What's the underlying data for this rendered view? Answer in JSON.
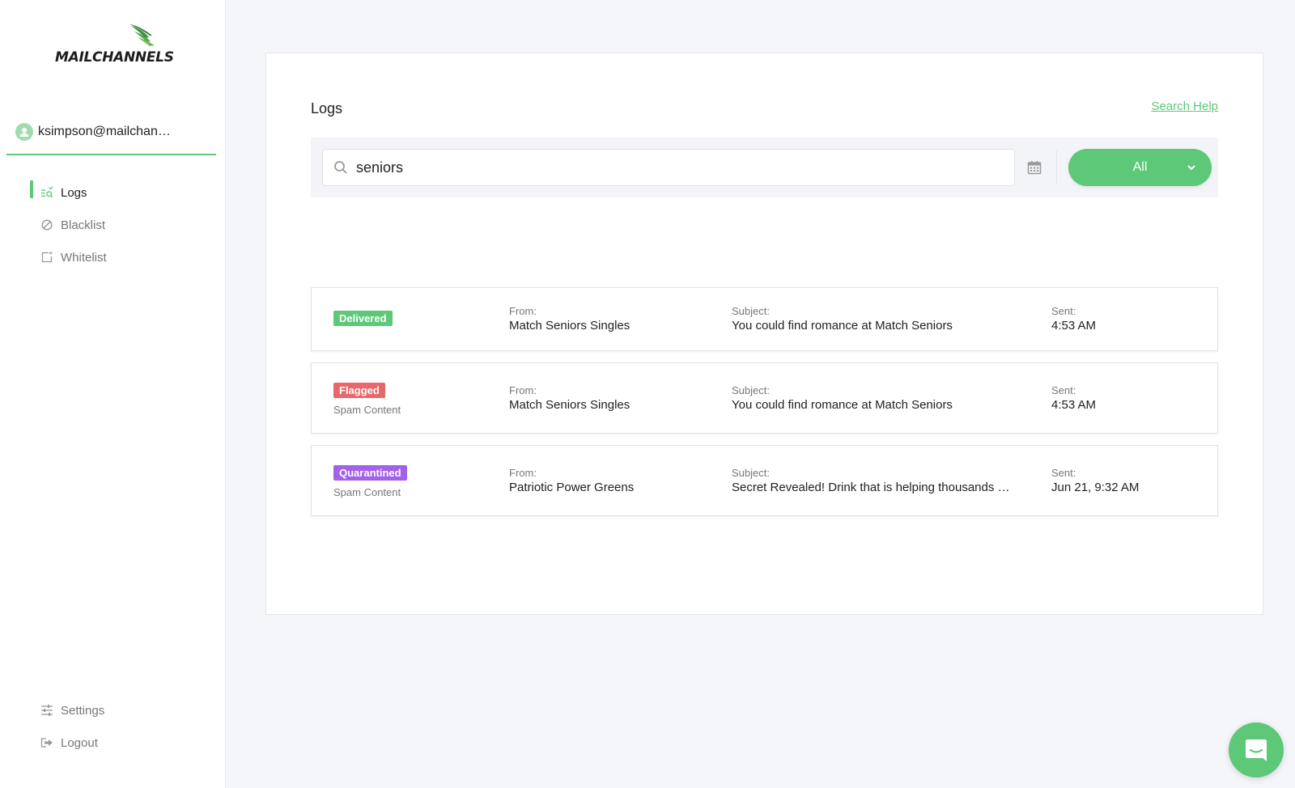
{
  "brand": {
    "name": "MAILCHANNELS",
    "accent": "#5cc878"
  },
  "user": {
    "email": "ksimpson@mailchann…"
  },
  "nav": {
    "items": [
      {
        "label": "Logs",
        "icon": "logs-icon",
        "active": true
      },
      {
        "label": "Blacklist",
        "icon": "blocked-icon",
        "active": false
      },
      {
        "label": "Whitelist",
        "icon": "checkbox-icon",
        "active": false
      }
    ],
    "bottom": [
      {
        "label": "Settings",
        "icon": "sliders-icon"
      },
      {
        "label": "Logout",
        "icon": "logout-icon"
      }
    ]
  },
  "main": {
    "title": "Logs",
    "search_help": "Search Help",
    "search": {
      "value": "seniors",
      "icon": "search-icon"
    },
    "calendar_icon": "calendar-icon",
    "filter": {
      "label": "All",
      "icon": "chevron-down-icon"
    },
    "logs": [
      {
        "status": "Delivered",
        "status_color": "#5cc878",
        "reason": "",
        "from_label": "From:",
        "from": "Match Seniors Singles",
        "subject_label": "Subject:",
        "subject": "You could find romance at Match Seniors",
        "sent_label": "Sent:",
        "sent": "4:53 AM"
      },
      {
        "status": "Flagged",
        "status_color": "#e9666a",
        "reason": "Spam Content",
        "from_label": "From:",
        "from": "Match Seniors Singles",
        "subject_label": "Subject:",
        "subject": "You could find romance at Match Seniors",
        "sent_label": "Sent:",
        "sent": "4:53 AM"
      },
      {
        "status": "Quarantined",
        "status_color": "#a361e9",
        "reason": "Spam Content",
        "from_label": "From:",
        "from": "Patriotic Power Greens",
        "subject_label": "Subject:",
        "subject": "Secret Revealed! Drink that is helping thousands …",
        "sent_label": "Sent:",
        "sent": "Jun 21, 9:32 AM"
      }
    ]
  },
  "chat": {
    "icon": "chat-icon"
  }
}
